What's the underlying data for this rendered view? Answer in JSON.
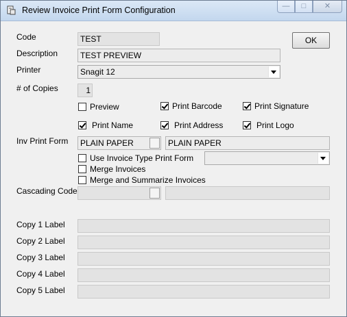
{
  "window": {
    "title": "Review Invoice Print Form Configuration"
  },
  "labels": {
    "code": "Code",
    "description": "Description",
    "printer": "Printer",
    "copies": "# of Copies",
    "inv_print_form": "Inv Print Form",
    "cascading_code": "Cascading Code",
    "copy1": "Copy 1 Label",
    "copy2": "Copy 2 Label",
    "copy3": "Copy 3 Label",
    "copy4": "Copy 4 Label",
    "copy5": "Copy 5 Label"
  },
  "values": {
    "code": "TEST",
    "description": "TEST PREVIEW",
    "printer": "Snagit 12",
    "copies": "1",
    "inv_print_form_code": "PLAIN PAPER",
    "inv_print_form_desc": "PLAIN PAPER",
    "invoice_type_form": "",
    "cascading_code": "",
    "cascading_desc": "",
    "copy1": "",
    "copy2": "",
    "copy3": "",
    "copy4": "",
    "copy5": ""
  },
  "checkboxes": {
    "preview": {
      "label": "Preview",
      "checked": false
    },
    "print_barcode": {
      "label": "Print Barcode",
      "checked": true
    },
    "print_signature": {
      "label": "Print Signature",
      "checked": true
    },
    "print_name": {
      "label": "Print Name",
      "checked": true
    },
    "print_address": {
      "label": "Print Address",
      "checked": true
    },
    "print_logo": {
      "label": "Print Logo",
      "checked": true
    },
    "use_invoice_type_print_form": {
      "label": "Use Invoice Type Print Form",
      "checked": false
    },
    "merge_invoices": {
      "label": "Merge Invoices",
      "checked": false
    },
    "merge_and_summarize": {
      "label": "Merge and Summarize Invoices",
      "checked": false
    }
  },
  "buttons": {
    "ok": "OK"
  }
}
